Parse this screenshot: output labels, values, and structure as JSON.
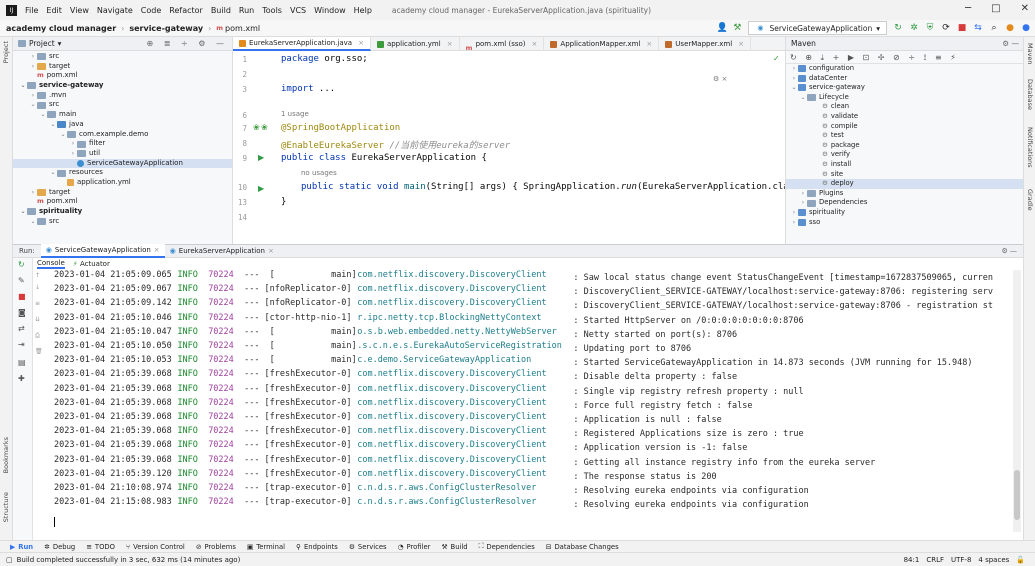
{
  "menu": {
    "items": [
      "File",
      "Edit",
      "View",
      "Navigate",
      "Code",
      "Refactor",
      "Build",
      "Run",
      "Tools",
      "VCS",
      "Window",
      "Help"
    ],
    "window_title": "academy cloud manager - EurekaServerApplication.java (spirituality)"
  },
  "nav": {
    "project": "academy cloud manager",
    "module": "service-gateway",
    "file": "pom.xml",
    "run_config": "ServiceGatewayApplication"
  },
  "project_panel": {
    "title": "Project",
    "items": [
      {
        "label": "src",
        "depth": 1,
        "arrow": ">",
        "icon": "folder"
      },
      {
        "label": "target",
        "depth": 1,
        "arrow": ">",
        "icon": "folder-orange"
      },
      {
        "label": "pom.xml",
        "depth": 1,
        "arrow": "",
        "icon": "maven"
      },
      {
        "label": "service-gateway",
        "depth": 0,
        "arrow": "v",
        "icon": "folder",
        "bold": true
      },
      {
        "label": ".mvn",
        "depth": 1,
        "arrow": ">",
        "icon": "folder"
      },
      {
        "label": "src",
        "depth": 1,
        "arrow": "v",
        "icon": "folder"
      },
      {
        "label": "main",
        "depth": 2,
        "arrow": "v",
        "icon": "folder"
      },
      {
        "label": "java",
        "depth": 3,
        "arrow": "v",
        "icon": "folder-blue"
      },
      {
        "label": "com.example.demo",
        "depth": 4,
        "arrow": "v",
        "icon": "folder"
      },
      {
        "label": "filter",
        "depth": 5,
        "arrow": ">",
        "icon": "folder"
      },
      {
        "label": "util",
        "depth": 5,
        "arrow": ">",
        "icon": "folder"
      },
      {
        "label": "ServiceGatewayApplication",
        "depth": 5,
        "arrow": "",
        "icon": "class",
        "selected": true
      },
      {
        "label": "resources",
        "depth": 3,
        "arrow": "v",
        "icon": "folder"
      },
      {
        "label": "application.yml",
        "depth": 4,
        "arrow": "",
        "icon": "yml"
      },
      {
        "label": "target",
        "depth": 1,
        "arrow": ">",
        "icon": "folder-orange"
      },
      {
        "label": "pom.xml",
        "depth": 1,
        "arrow": "",
        "icon": "maven"
      },
      {
        "label": "spirituality",
        "depth": 0,
        "arrow": "v",
        "icon": "folder",
        "bold": true
      },
      {
        "label": "src",
        "depth": 1,
        "arrow": "v",
        "icon": "folder"
      }
    ]
  },
  "editor_tabs": [
    {
      "label": "EurekaServerApplication.java",
      "active": true
    },
    {
      "label": "application.yml",
      "active": false
    },
    {
      "label": "pom.xml (sso)",
      "active": false
    },
    {
      "label": "ApplicationMapper.xml",
      "active": false
    },
    {
      "label": "UserMapper.xml",
      "active": false
    }
  ],
  "editor": {
    "line_numbers": [
      "1",
      "2",
      "3",
      "",
      "6",
      "",
      "7",
      "8",
      "9",
      "",
      "10",
      "13",
      "14"
    ],
    "package_kw": "package",
    "package_name": " org.sso;",
    "import_kw": "import",
    "import_rest": " ...",
    "usage_hint": "1 usage",
    "ann1": "@SpringBootApplication",
    "ann2": "@EnableEurekaServer",
    "comment": " //当前使用eureka的server",
    "class_decl_kw": "public class",
    "class_name": " EurekaServerApplication {",
    "no_usages": "no usages",
    "main_kw": "public static void",
    "main_name": " main",
    "main_args": "(String[] args) { SpringApplication.",
    "run_call": "run",
    "run_args": "(EurekaServerApplication.clas",
    "closing": "}"
  },
  "maven": {
    "title": "Maven",
    "items": [
      {
        "label": "configuration",
        "depth": 0,
        "arrow": ">",
        "icon": "maven"
      },
      {
        "label": "dataCenter",
        "depth": 0,
        "arrow": ">",
        "icon": "maven"
      },
      {
        "label": "service-gateway",
        "depth": 0,
        "arrow": "v",
        "icon": "maven"
      },
      {
        "label": "Lifecycle",
        "depth": 1,
        "arrow": "v",
        "icon": "folder"
      },
      {
        "label": "clean",
        "depth": 2,
        "arrow": "",
        "icon": "gear"
      },
      {
        "label": "validate",
        "depth": 2,
        "arrow": "",
        "icon": "gear"
      },
      {
        "label": "compile",
        "depth": 2,
        "arrow": "",
        "icon": "gear"
      },
      {
        "label": "test",
        "depth": 2,
        "arrow": "",
        "icon": "gear"
      },
      {
        "label": "package",
        "depth": 2,
        "arrow": "",
        "icon": "gear"
      },
      {
        "label": "verify",
        "depth": 2,
        "arrow": "",
        "icon": "gear"
      },
      {
        "label": "install",
        "depth": 2,
        "arrow": "",
        "icon": "gear"
      },
      {
        "label": "site",
        "depth": 2,
        "arrow": "",
        "icon": "gear"
      },
      {
        "label": "deploy",
        "depth": 2,
        "arrow": "",
        "icon": "gear",
        "selected": true
      },
      {
        "label": "Plugins",
        "depth": 1,
        "arrow": ">",
        "icon": "folder"
      },
      {
        "label": "Dependencies",
        "depth": 1,
        "arrow": ">",
        "icon": "folder"
      },
      {
        "label": "spirituality",
        "depth": 0,
        "arrow": ">",
        "icon": "maven"
      },
      {
        "label": "sso",
        "depth": 0,
        "arrow": ">",
        "icon": "maven"
      }
    ]
  },
  "run_panel": {
    "label": "Run:",
    "tabs": [
      {
        "label": "ServiceGatewayApplication",
        "active": true
      },
      {
        "label": "EurekaServerApplication",
        "active": false
      }
    ],
    "console_tabs": [
      "Console",
      "Actuator"
    ]
  },
  "logs": [
    {
      "ts": "2023-01-04 21:05:09.065",
      "lvl": "INFO",
      "pid": "70224",
      "thread": "---  [           main]",
      "cls": "com.netflix.discovery.DiscoveryClient",
      "msg": ": Saw local status change event StatusChangeEvent [timestamp=1672837509065, curren"
    },
    {
      "ts": "2023-01-04 21:05:09.067",
      "lvl": "INFO",
      "pid": "70224",
      "thread": "--- [nfoReplicator-0]",
      "cls": "com.netflix.discovery.DiscoveryClient",
      "msg": ": DiscoveryClient_SERVICE-GATEWAY/localhost:service-gateway:8706: registering serv"
    },
    {
      "ts": "2023-01-04 21:05:09.142",
      "lvl": "INFO",
      "pid": "70224",
      "thread": "--- [nfoReplicator-0]",
      "cls": "com.netflix.discovery.DiscoveryClient",
      "msg": ": DiscoveryClient_SERVICE-GATEWAY/localhost:service-gateway:8706 - registration st"
    },
    {
      "ts": "2023-01-04 21:05:10.046",
      "lvl": "INFO",
      "pid": "70224",
      "thread": "--- [ctor-http-nio-1]",
      "cls": "r.ipc.netty.tcp.BlockingNettyContext",
      "msg": ": Started HttpServer on /0:0:0:0:0:0:0:0:8706"
    },
    {
      "ts": "2023-01-04 21:05:10.047",
      "lvl": "INFO",
      "pid": "70224",
      "thread": "---  [           main]",
      "cls": "o.s.b.web.embedded.netty.NettyWebServer",
      "msg": ": Netty started on port(s): 8706"
    },
    {
      "ts": "2023-01-04 21:05:10.050",
      "lvl": "INFO",
      "pid": "70224",
      "thread": "---  [           main]",
      "cls": ".s.c.n.e.s.EurekaAutoServiceRegistration",
      "msg": ": Updating port to 8706"
    },
    {
      "ts": "2023-01-04 21:05:10.053",
      "lvl": "INFO",
      "pid": "70224",
      "thread": "---  [           main]",
      "cls": "c.e.demo.ServiceGatewayApplication",
      "msg": ": Started ServiceGatewayApplication in 14.873 seconds (JVM running for 15.948)"
    },
    {
      "ts": "2023-01-04 21:05:39.068",
      "lvl": "INFO",
      "pid": "70224",
      "thread": "--- [freshExecutor-0]",
      "cls": "com.netflix.discovery.DiscoveryClient",
      "msg": ": Disable delta property : false"
    },
    {
      "ts": "2023-01-04 21:05:39.068",
      "lvl": "INFO",
      "pid": "70224",
      "thread": "--- [freshExecutor-0]",
      "cls": "com.netflix.discovery.DiscoveryClient",
      "msg": ": Single vip registry refresh property : null"
    },
    {
      "ts": "2023-01-04 21:05:39.068",
      "lvl": "INFO",
      "pid": "70224",
      "thread": "--- [freshExecutor-0]",
      "cls": "com.netflix.discovery.DiscoveryClient",
      "msg": ": Force full registry fetch : false"
    },
    {
      "ts": "2023-01-04 21:05:39.068",
      "lvl": "INFO",
      "pid": "70224",
      "thread": "--- [freshExecutor-0]",
      "cls": "com.netflix.discovery.DiscoveryClient",
      "msg": ": Application is null : false"
    },
    {
      "ts": "2023-01-04 21:05:39.068",
      "lvl": "INFO",
      "pid": "70224",
      "thread": "--- [freshExecutor-0]",
      "cls": "com.netflix.discovery.DiscoveryClient",
      "msg": ": Registered Applications size is zero : true"
    },
    {
      "ts": "2023-01-04 21:05:39.068",
      "lvl": "INFO",
      "pid": "70224",
      "thread": "--- [freshExecutor-0]",
      "cls": "com.netflix.discovery.DiscoveryClient",
      "msg": ": Application version is -1: false"
    },
    {
      "ts": "2023-01-04 21:05:39.068",
      "lvl": "INFO",
      "pid": "70224",
      "thread": "--- [freshExecutor-0]",
      "cls": "com.netflix.discovery.DiscoveryClient",
      "msg": ": Getting all instance registry info from the eureka server"
    },
    {
      "ts": "2023-01-04 21:05:39.120",
      "lvl": "INFO",
      "pid": "70224",
      "thread": "--- [freshExecutor-0]",
      "cls": "com.netflix.discovery.DiscoveryClient",
      "msg": ": The response status is 200"
    },
    {
      "ts": "2023-01-04 21:10:08.974",
      "lvl": "INFO",
      "pid": "70224",
      "thread": "--- [trap-executor-0]",
      "cls": "c.n.d.s.r.aws.ConfigClusterResolver",
      "msg": ": Resolving eureka endpoints via configuration"
    },
    {
      "ts": "2023-01-04 21:15:08.983",
      "lvl": "INFO",
      "pid": "70224",
      "thread": "--- [trap-executor-0]",
      "cls": "c.n.d.s.r.aws.ConfigClusterResolver",
      "msg": ": Resolving eureka endpoints via configuration"
    }
  ],
  "bottom_tabs": [
    "Run",
    "Debug",
    "TODO",
    "Version Control",
    "Problems",
    "Terminal",
    "Endpoints",
    "Services",
    "Profiler",
    "Build",
    "Dependencies",
    "Database Changes"
  ],
  "status": {
    "message": "Build completed successfully in 3 sec, 632 ms (14 minutes ago)",
    "position": "84:1",
    "line_sep": "CRLF",
    "encoding": "UTF-8",
    "indent": "4 spaces"
  },
  "side_labels": {
    "project": "Project",
    "bookmarks": "Bookmarks",
    "structure": "Structure",
    "maven": "Maven",
    "database": "Database",
    "notifications": "Notifications",
    "gradle": "Gradle"
  }
}
